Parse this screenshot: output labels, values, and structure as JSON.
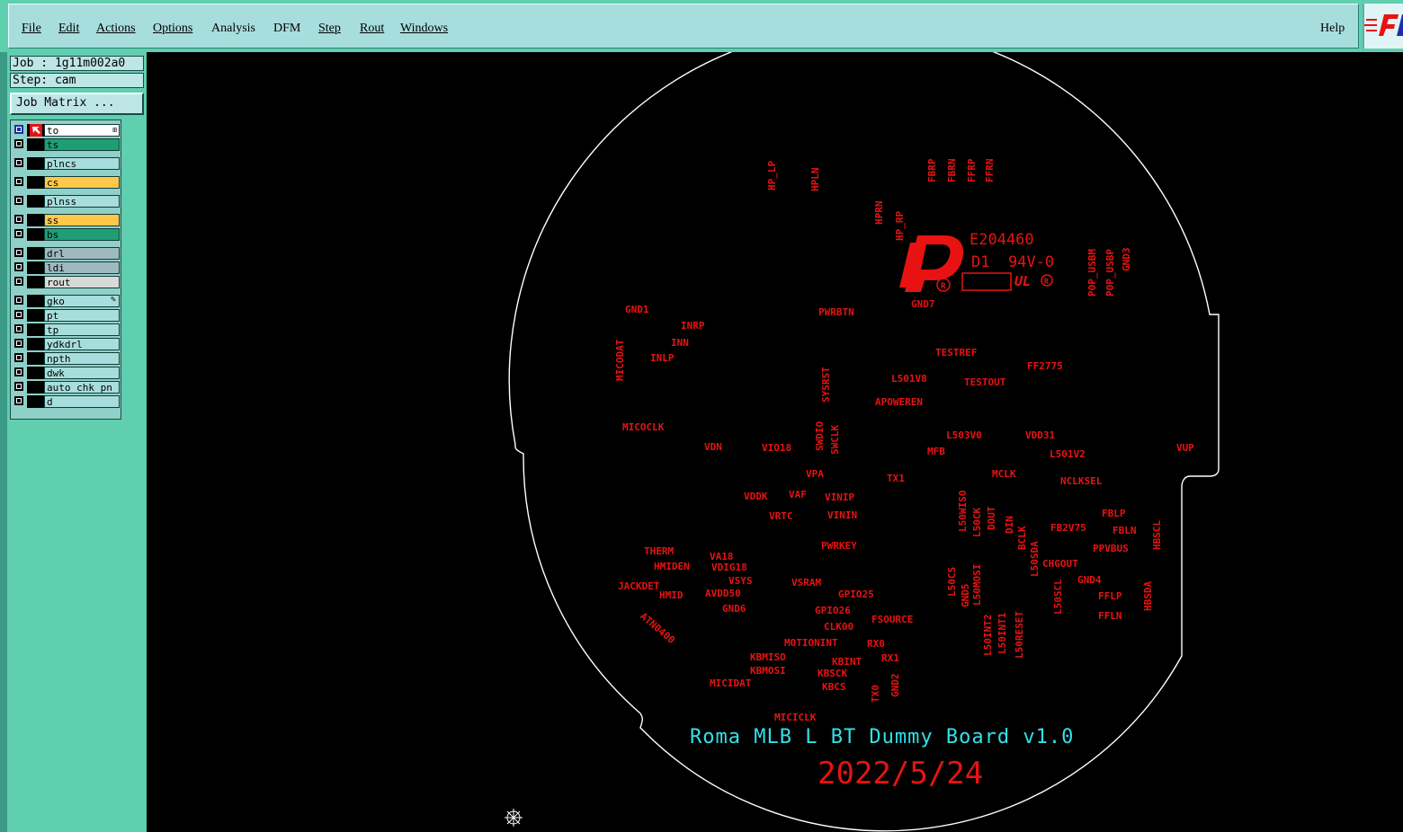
{
  "menu": {
    "items": [
      "File",
      "Edit",
      "Actions",
      "Options",
      "Analysis",
      "DFM",
      "Step",
      "Rout",
      "Windows"
    ],
    "help": "Help"
  },
  "job": {
    "job_label": "Job : 1g11m002a0",
    "step_label": "Step: cam",
    "job_matrix_button": "Job Matrix ..."
  },
  "layers": [
    {
      "name": "to",
      "color": "#ffffff"
    },
    {
      "name": "ts",
      "color": "#1f9e74"
    },
    {
      "name": "plncs",
      "color": "#a7dedd"
    },
    {
      "name": "cs",
      "color": "#ffc84a"
    },
    {
      "name": "plnss",
      "color": "#a7dedd"
    },
    {
      "name": "ss",
      "color": "#ffc84a"
    },
    {
      "name": "bs",
      "color": "#1f9e74"
    },
    {
      "name": "drl",
      "color": "#9fb9c1"
    },
    {
      "name": "ldi",
      "color": "#9fb9c1"
    },
    {
      "name": "rout",
      "color": "#d9d9d9"
    },
    {
      "name": "gko",
      "color": "#a7dedd"
    },
    {
      "name": "pt",
      "color": "#a7dedd"
    },
    {
      "name": "tp",
      "color": "#a7dedd"
    },
    {
      "name": "ydkdrl",
      "color": "#a7dedd"
    },
    {
      "name": "npth",
      "color": "#a7dedd"
    },
    {
      "name": "dwk",
      "color": "#a7dedd"
    },
    {
      "name": "auto_chk_pn",
      "color": "#a7dedd"
    },
    {
      "name": "d",
      "color": "#a7dedd"
    }
  ],
  "board": {
    "title": "Roma MLB L BT Dummy Board v1.0",
    "date": "2022/5/24",
    "ul_code": "E204460",
    "ul_rating": "D1  94V-0",
    "labels": [
      "HP_LP",
      "HPLN",
      "FBRP",
      "FBRN",
      "FFRP",
      "FFRN",
      "HPRN",
      "HP_RP",
      "POP_USBM",
      "POP_USBP",
      "GND3",
      "GND7",
      "GND1",
      "INRP",
      "INN",
      "INLP",
      "MICODAT",
      "PWRBTN",
      "TESTREF",
      "FF2775",
      "L501V8",
      "TESTOUT",
      "SYSRST",
      "APOWEREN",
      "MICOCLK",
      "VDN",
      "VIO18",
      "SWDIO",
      "SWCLK",
      "L503V0",
      "VDD31",
      "MFB",
      "L501V2",
      "VUP",
      "VPA",
      "TX1",
      "MCLK",
      "NCLKSEL",
      "VDDK",
      "VAF",
      "VINIP",
      "VRTC",
      "VININ",
      "L50WISO",
      "L50CK",
      "DOUT",
      "DIN",
      "BCLK",
      "FBLP",
      "FB2V75",
      "FBLN",
      "HBSCL",
      "PWRKEY",
      "L50SDA",
      "PPVBUS",
      "THERM",
      "HMIDEN",
      "VA18",
      "VDIG18",
      "VSYS",
      "CHGOUT",
      "JACKDET",
      "VSRAM",
      "GND4",
      "HMID",
      "AVDD50",
      "GPIO25",
      "L50CS",
      "GND5",
      "L50MOSI",
      "L50SCL",
      "FFLP",
      "HBSDA",
      "GND6",
      "GPIO26",
      "FSOURCE",
      "CLK00",
      "ATN0400",
      "FFLN",
      "MOTIONINT",
      "RX0",
      "L50INT2",
      "L50INT1",
      "L50RESET",
      "KBMISO",
      "KBINT",
      "KBMOSI",
      "RX1",
      "KBSCK",
      "MICIDAT",
      "KBCS",
      "GND2",
      "TX0",
      "MICICLK"
    ]
  },
  "colors": {
    "menubar": "#a7dedd",
    "panel": "#5fcfb0",
    "silkscreen": "#e81212",
    "title_text": "#33e0e8",
    "outline": "#ffffff"
  },
  "icons": [
    "arrow-cursor-icon",
    "layer-menu-icon",
    "pencil-icon",
    "frontline-logo-icon",
    "crosshair-origin-icon"
  ]
}
